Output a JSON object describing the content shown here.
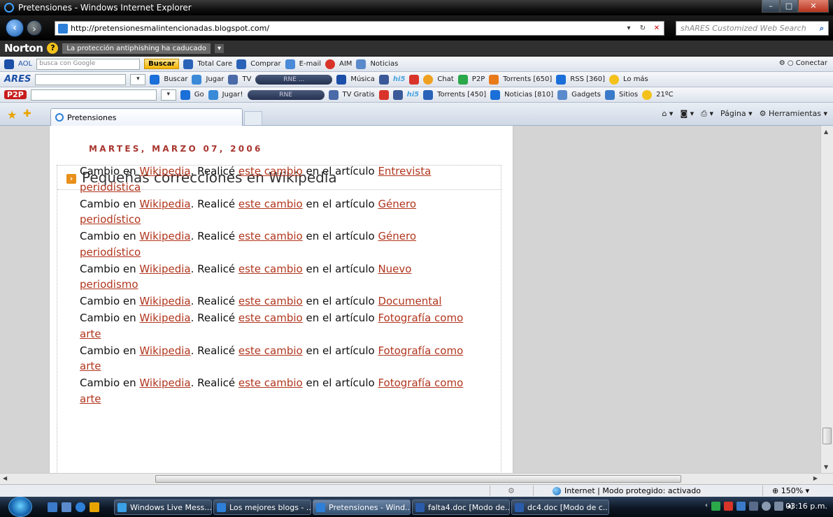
{
  "window": {
    "title": "Pretensiones - Windows Internet Explorer"
  },
  "address": {
    "url": "http://pretensionesmalintencionadas.blogspot.com/",
    "search_placeholder": "shARES Customized Web Search"
  },
  "norton": {
    "logo": "Norton",
    "warning": "La protección antiphishing ha caducado"
  },
  "aol_toolbar": {
    "aol": "AOL",
    "search_hint": "busca con Google",
    "buscar": "Buscar",
    "total_care": "Total Care",
    "comprar": "Comprar",
    "email": "E-mail",
    "aim": "AIM",
    "noticias": "Noticias",
    "conectar": "Conectar"
  },
  "ares_toolbar": {
    "logo": "ARES",
    "buscar": "Buscar",
    "jugar": "Jugar",
    "tv": "TV",
    "rne": "RNE ...",
    "musica": "Música",
    "chat": "Chat",
    "p2p": "P2P",
    "torrents": "Torrents [650]",
    "rss": "RSS [360]",
    "lo_mas": "Lo más"
  },
  "p2p_toolbar": {
    "logo": "P2P",
    "go": "Go",
    "jugar": "Jugar!",
    "rne": "RNE",
    "tv_gratis": "TV Gratis",
    "torrents": "Torrents [450]",
    "noticias": "Noticias [810]",
    "gadgets": "Gadgets",
    "sitios": "Sitios",
    "temp": "21ºC"
  },
  "tab": {
    "label": "Pretensiones"
  },
  "commandbar": {
    "pagina": "Página",
    "herramientas": "Herramientas"
  },
  "post": {
    "date": "MARTES, MARZO 07, 2006",
    "title": "Pequeñas correcciones en Wikipedia",
    "entries": [
      {
        "a": "Cambio en ",
        "wiki": "Wikipedia",
        "b": ". Realicé ",
        "cambio": "este cambio",
        "c": " en el artículo ",
        "articulo": "Entrevista periodística"
      },
      {
        "a": "Cambio en ",
        "wiki": "Wikipedia",
        "b": ". Realicé ",
        "cambio": "este cambio",
        "c": " en el artículo ",
        "articulo": "Género periodístico"
      },
      {
        "a": "Cambio en ",
        "wiki": "Wikipedia",
        "b": ". Realicé ",
        "cambio": "este cambio",
        "c": " en el artículo ",
        "articulo": "Género periodístico"
      },
      {
        "a": "Cambio en ",
        "wiki": "Wikipedia",
        "b": ". Realicé ",
        "cambio": "este cambio",
        "c": " en el artículo ",
        "articulo": "Nuevo periodismo"
      },
      {
        "a": "Cambio en ",
        "wiki": "Wikipedia",
        "b": ". Realicé ",
        "cambio": "este cambio",
        "c": " en el artículo ",
        "articulo": "Documental"
      },
      {
        "a": "Cambio en ",
        "wiki": "Wikipedia",
        "b": ". Realicé ",
        "cambio": "este cambio",
        "c": " en el artículo ",
        "articulo": "Fotografía como arte"
      },
      {
        "a": "Cambio en ",
        "wiki": "Wikipedia",
        "b": ". Realicé ",
        "cambio": "este cambio",
        "c": " en el artículo ",
        "articulo": "Fotografía como arte"
      },
      {
        "a": "Cambio en ",
        "wiki": "Wikipedia",
        "b": ". Realicé ",
        "cambio": "este cambio",
        "c": " en el artículo ",
        "articulo": "Fotografía como arte"
      }
    ]
  },
  "status": {
    "zone": "Internet | Modo protegido: activado",
    "zoom": "150%"
  },
  "taskbar": {
    "tasks": [
      {
        "label": "Windows Live Mess...",
        "color": "#3aa0e8"
      },
      {
        "label": "Los mejores blogs - ...",
        "color": "#2d7fd8"
      },
      {
        "label": "Pretensiones - Wind...",
        "color": "#2d7fd8"
      },
      {
        "label": "falta4.doc [Modo de...",
        "color": "#2a5caa"
      },
      {
        "label": "dc4.doc [Modo de c...",
        "color": "#2a5caa"
      }
    ],
    "clock": "03:16 p.m."
  },
  "colors": {
    "link": "#b1361e",
    "date_header": "#a8362f"
  }
}
